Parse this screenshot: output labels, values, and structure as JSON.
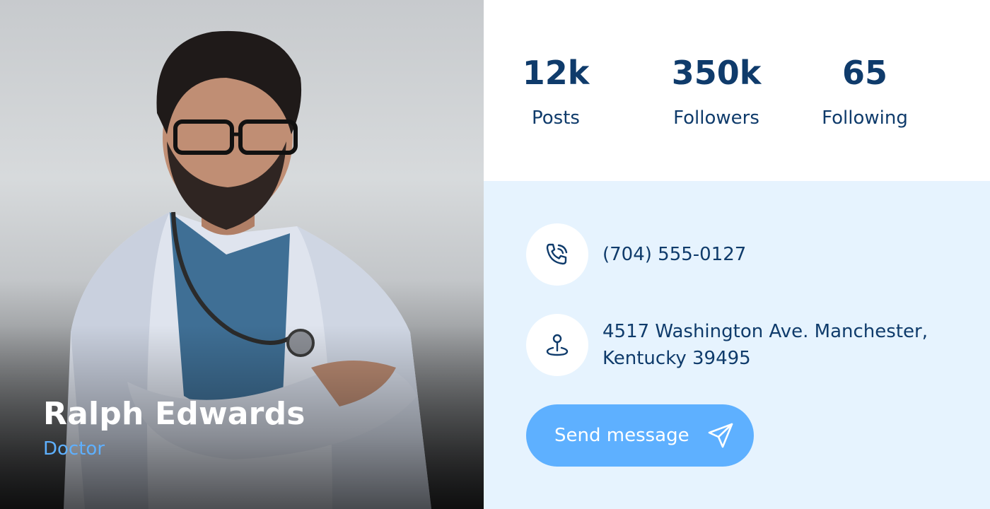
{
  "profile": {
    "name": "Ralph Edwards",
    "role": "Doctor"
  },
  "stats": [
    {
      "value": "12k",
      "label": "Posts"
    },
    {
      "value": "350k",
      "label": "Followers"
    },
    {
      "value": "65",
      "label": "Following"
    }
  ],
  "contact": {
    "phone": "(704) 555-0127",
    "address": "4517 Washington Ave. Manchester, Kentucky 39495"
  },
  "actions": {
    "send_label": "Send message"
  },
  "icons": {
    "phone": "phone-icon",
    "location": "location-pin-icon",
    "send": "paper-plane-icon"
  },
  "colors": {
    "accent": "#5eb0ff",
    "text_dark": "#0f3b6b",
    "panel_bg": "#e6f3fe"
  }
}
